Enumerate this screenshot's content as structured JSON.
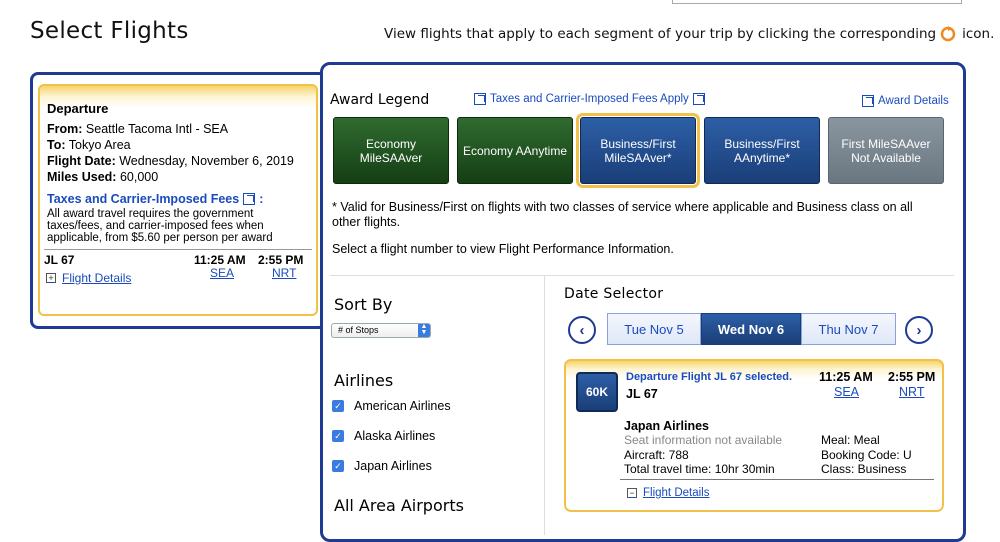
{
  "page": {
    "title": "Select Flights",
    "instructions_before": "View flights that apply to each segment of your trip by clicking the corresponding",
    "instructions_after": "icon."
  },
  "segment": {
    "heading": "Departure",
    "from_label": "From:",
    "from_value": "Seattle Tacoma Intl - SEA",
    "to_label": "To:",
    "to_value": "Tokyo Area",
    "date_label": "Flight Date:",
    "date_value": "Wednesday, November 6, 2019",
    "miles_label": "Miles Used:",
    "miles_value": "60,000",
    "fees_link": "Taxes and Carrier-Imposed Fees",
    "fees_colon": ":",
    "fees_text": "All award travel requires the government taxes/fees, and carrier-imposed fees when applicable, from $5.60 per person per award",
    "flight_number": "JL 67",
    "depart_time": "11:25 AM",
    "depart_code": "SEA",
    "arrive_time": "2:55 PM",
    "arrive_code": "NRT",
    "details_link": "Flight Details"
  },
  "legend": {
    "title": "Award Legend",
    "fees_link": "Taxes and Carrier-Imposed Fees Apply",
    "award_details": "Award Details",
    "boxes": [
      {
        "label": "Economy MileSAAver",
        "color": "#1f4f1f"
      },
      {
        "label": "Economy AAnytime",
        "color": "#1f4f1f"
      },
      {
        "label": "Business/First MileSAAver*",
        "color": "#24508f",
        "selected": true
      },
      {
        "label": "Business/First AAnytime*",
        "color": "#24508f"
      },
      {
        "label": "First MileSAAver Not Available",
        "color": "#7a868f"
      }
    ],
    "valid_note": "* Valid for Business/First on flights with two classes of service where applicable and Business class on all other flights.",
    "select_note": "Select a flight number to view Flight Performance Information."
  },
  "sort": {
    "title": "Sort By",
    "selected": "# of Stops"
  },
  "airlines": {
    "title": "Airlines",
    "items": [
      {
        "label": "American Airlines",
        "checked": true
      },
      {
        "label": "Alaska Airlines",
        "checked": true
      },
      {
        "label": "Japan Airlines",
        "checked": true
      }
    ]
  },
  "airports": {
    "title": "All Area Airports"
  },
  "date_selector": {
    "title": "Date Selector",
    "prev_icon": "chevron-left-icon",
    "next_icon": "chevron-right-icon",
    "dates": [
      "Tue Nov 5",
      "Wed Nov 6",
      "Thu Nov 7"
    ],
    "selected_index": 1
  },
  "flight": {
    "miles_badge": "60K",
    "selected_text": "Departure Flight JL 67 selected.",
    "flight_number": "JL 67",
    "depart_time": "11:25 AM",
    "depart_code": "SEA",
    "arrive_time": "2:55 PM",
    "arrive_code": "NRT",
    "airline": "Japan Airlines",
    "seat_info": "Seat information not available",
    "aircraft": "Aircraft: 788",
    "travel_time": "Total travel time: 10hr 30min",
    "meal": "Meal: Meal",
    "booking_code": "Booking Code: U",
    "class": "Class: Business",
    "details_link": "Flight Details"
  },
  "colors": {
    "brand_navy": "#1f3a93",
    "link_blue": "#1a4bbd",
    "highlight_gold": "#f2c14a",
    "checkbox_blue": "#3a7be0"
  }
}
